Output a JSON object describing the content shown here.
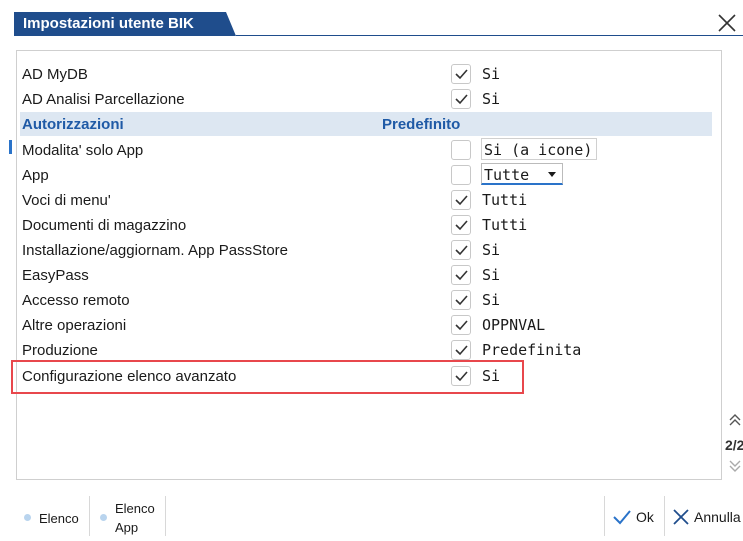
{
  "window": {
    "title": "Impostazioni utente BIK",
    "close_icon": "close-icon",
    "accent_color": "#1f4d8c"
  },
  "rows_top": [
    {
      "label": "AD MyDB",
      "checked": true,
      "value": "Si"
    },
    {
      "label": "AD Analisi Parcellazione",
      "checked": true,
      "value": "Si"
    }
  ],
  "section": {
    "header_label": "Autorizzazioni",
    "header_value": "Predefinito"
  },
  "rows": [
    {
      "label": "Modalita' solo App",
      "checked": false,
      "value": "Si (a icone)"
    },
    {
      "label": "App",
      "checked": false,
      "value": "Tutte"
    },
    {
      "label": "Voci di menu'",
      "checked": true,
      "value": "Tutti"
    },
    {
      "label": "Documenti di magazzino",
      "checked": true,
      "value": "Tutti"
    },
    {
      "label": "Installazione/aggiornam. App PassStore",
      "checked": true,
      "value": "Si"
    },
    {
      "label": "EasyPass",
      "checked": true,
      "value": "Si"
    },
    {
      "label": "Accesso remoto",
      "checked": true,
      "value": "Si"
    },
    {
      "label": "Altre operazioni",
      "checked": true,
      "value": "OPPNVAL"
    },
    {
      "label": "Produzione",
      "checked": true,
      "value": "Predefinita"
    },
    {
      "label": "Configurazione elenco avanzato",
      "checked": true,
      "value": "Si"
    }
  ],
  "pager": {
    "text": "2/2"
  },
  "bottom": {
    "tab_elenco": "Elenco",
    "tab_elenco_app_line1": "Elenco",
    "tab_elenco_app_line2": "App",
    "ok_label": "Ok",
    "annulla_label": "Annulla"
  },
  "highlight_color": "#e8474c"
}
